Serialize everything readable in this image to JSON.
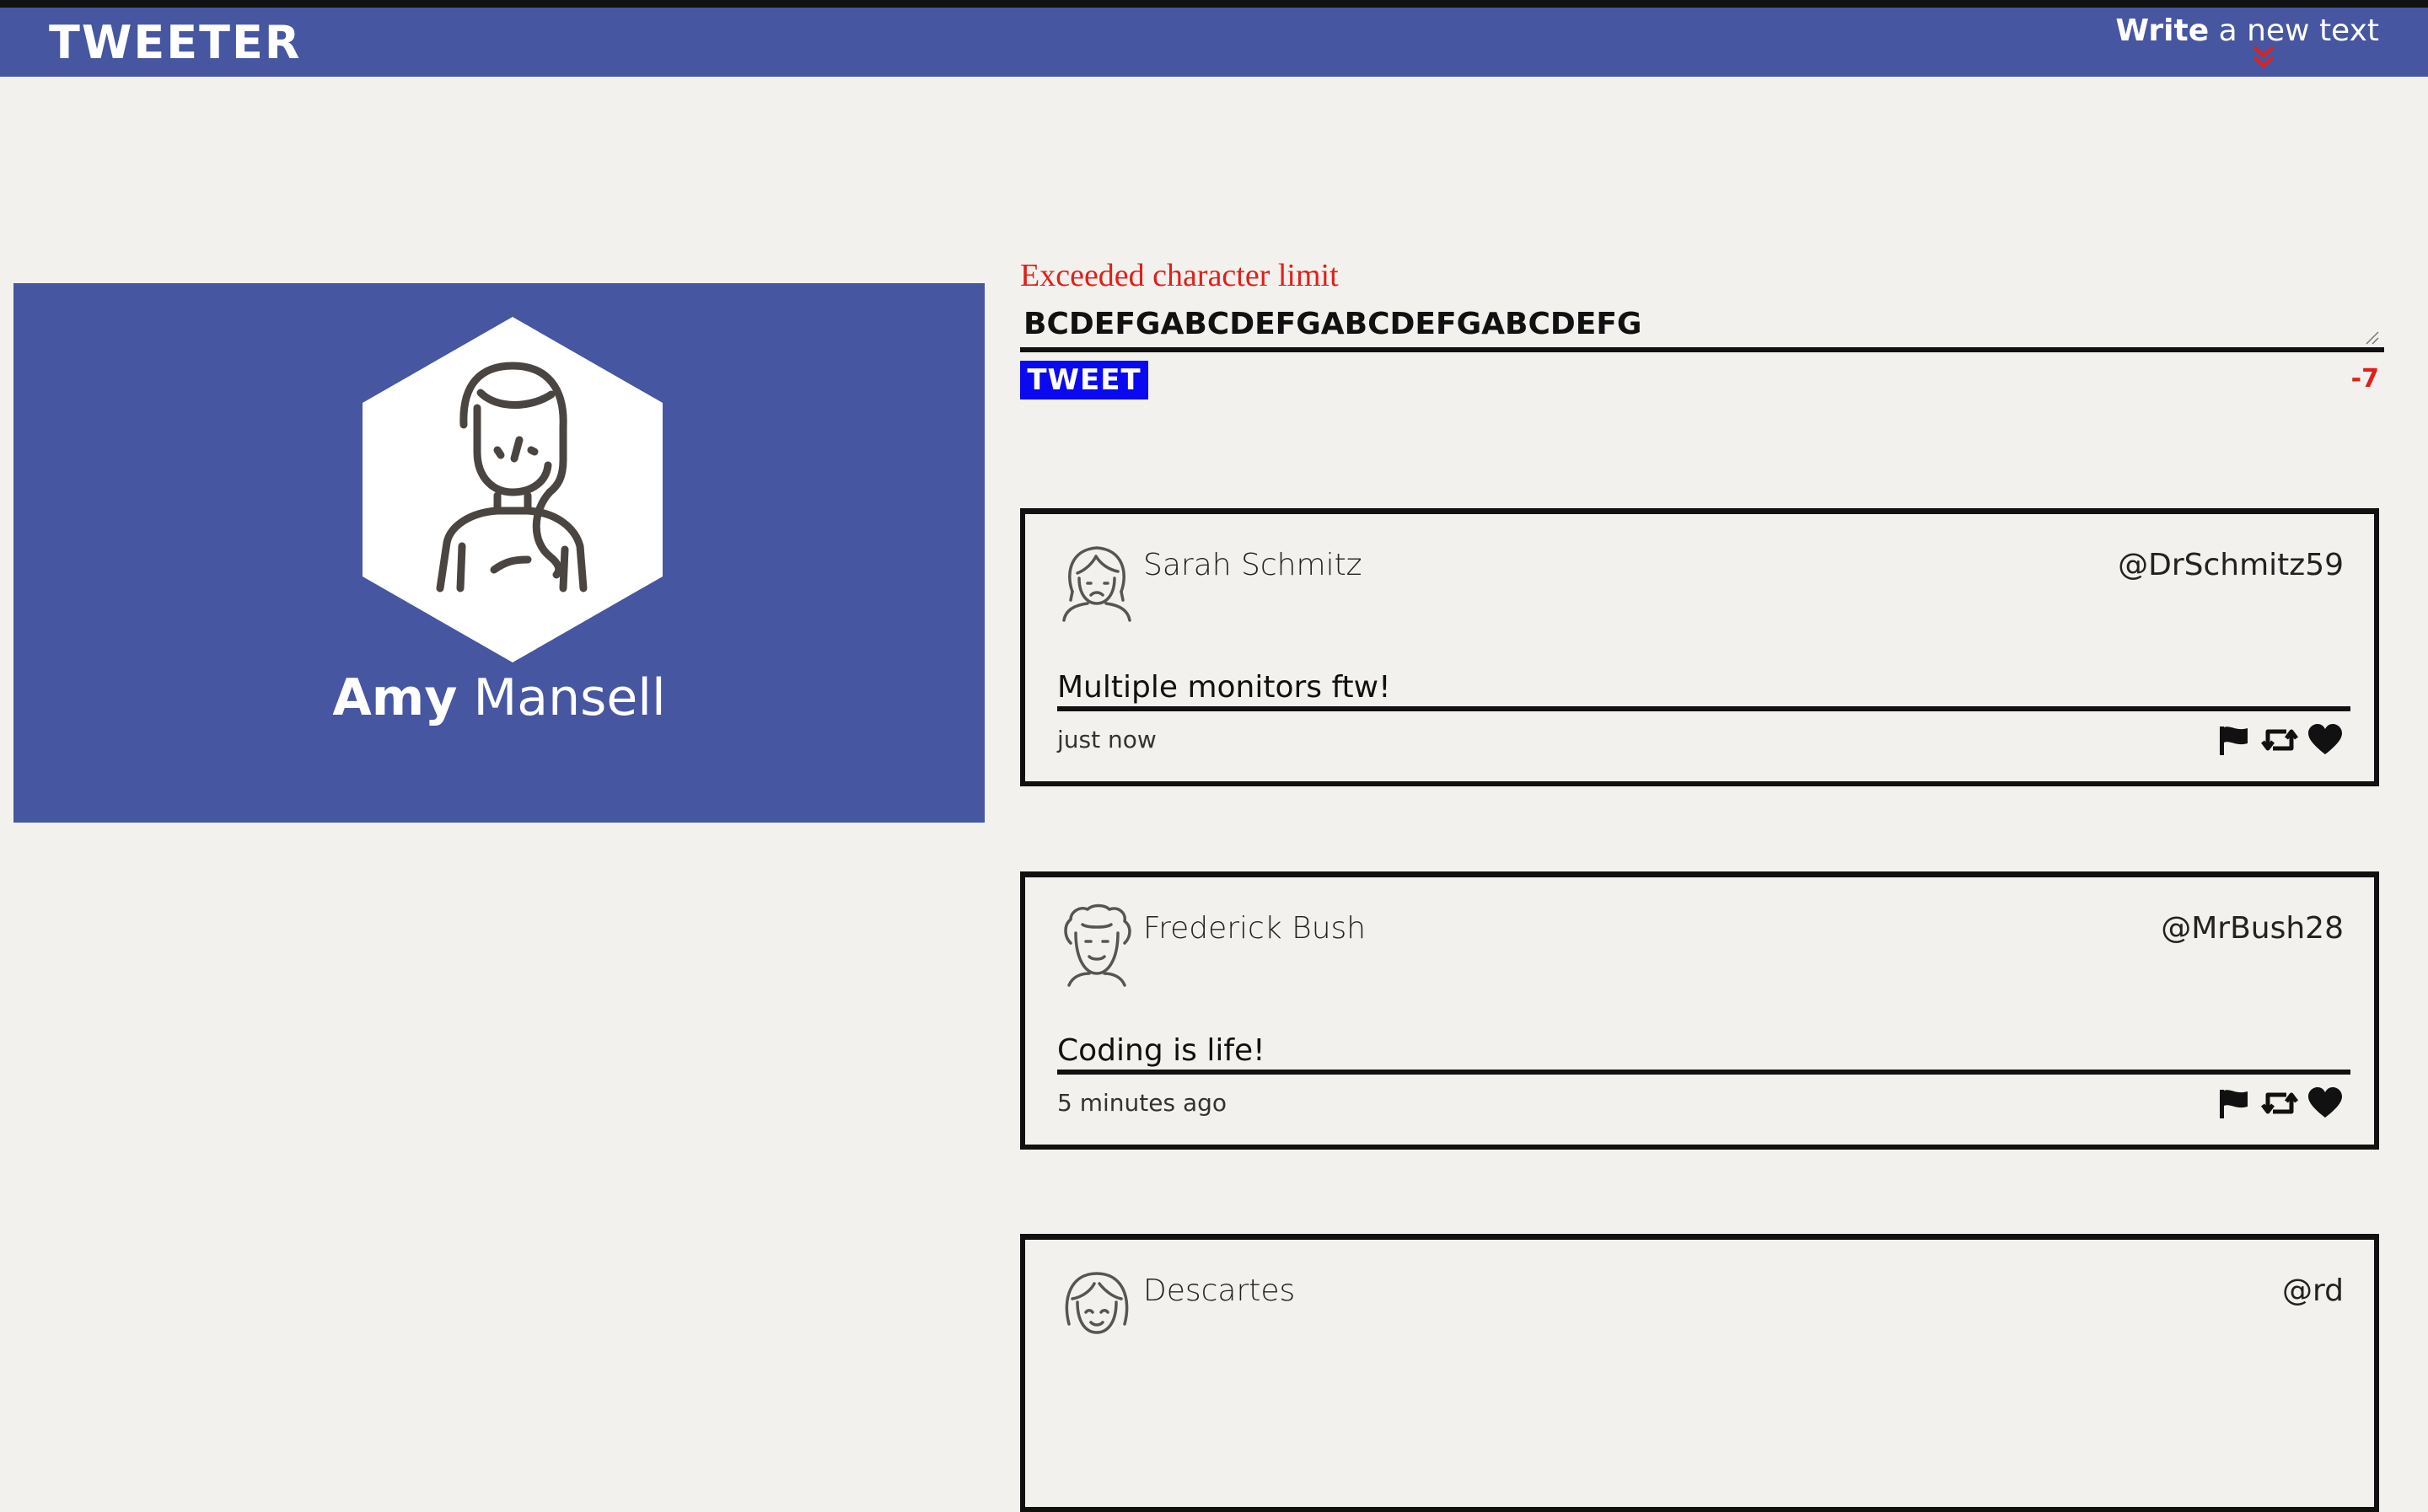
{
  "navbar": {
    "brand": "TWEETER",
    "write_bold": "Write",
    "write_rest": " a new text"
  },
  "profile": {
    "first_name": "Amy",
    "last_name": "Mansell"
  },
  "composer": {
    "error": "Exceeded character limit",
    "text": "BCDEFGABCDEFGABCDEFGABCDEFG",
    "button_label": "TWEET",
    "remaining": "-7"
  },
  "tweets": [
    {
      "name": "Sarah Schmitz",
      "handle": "@DrSchmitz59",
      "content": "Multiple monitors ftw!",
      "time": "just now"
    },
    {
      "name": "Frederick Bush",
      "handle": "@MrBush28",
      "content": "Coding is life!",
      "time": "5 minutes ago"
    },
    {
      "name": "Descartes",
      "handle": "@rd",
      "content": "",
      "time": ""
    }
  ],
  "colors": {
    "primary": "#4656a0",
    "background": "#f2f1ed",
    "error": "#e0201a",
    "button": "#0a09f0"
  },
  "icons": {
    "flag": "flag-icon",
    "retweet": "retweet-icon",
    "like": "heart-icon"
  }
}
